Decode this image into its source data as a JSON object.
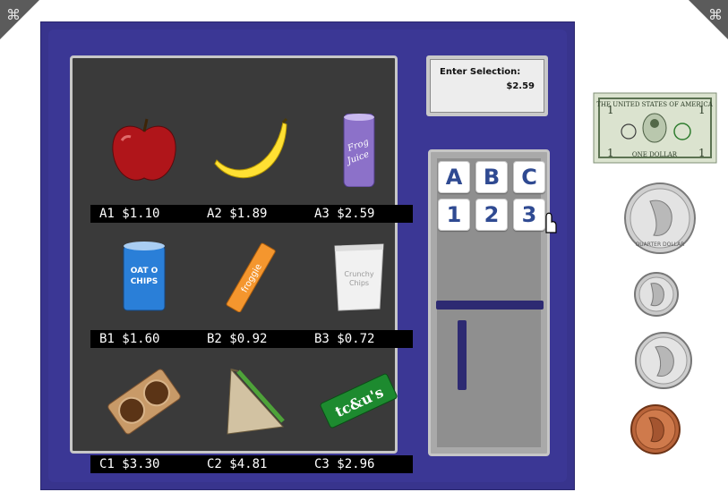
{
  "display": {
    "title": "Enter Selection:",
    "price": "$2.59"
  },
  "products": [
    {
      "code": "A1 $1.10",
      "name": "apple"
    },
    {
      "code": "A2 $1.89",
      "name": "banana"
    },
    {
      "code": "A3 $2.59",
      "name": "frog-juice-can",
      "text": "Frog Juice"
    },
    {
      "code": "B1 $1.60",
      "name": "oat-o-chips-can",
      "text": "OAT O CHIPS"
    },
    {
      "code": "B2 $0.92",
      "name": "froggie-bar",
      "text": "froggie"
    },
    {
      "code": "B3 $0.72",
      "name": "chips-bag",
      "text": "Crunchy Chips"
    },
    {
      "code": "C1 $3.30",
      "name": "cookies-pack"
    },
    {
      "code": "C2 $4.81",
      "name": "sandwich"
    },
    {
      "code": "C3 $2.96",
      "name": "candy-bar",
      "text": "tc&u's"
    }
  ],
  "keypad": {
    "row1": [
      "A",
      "B",
      "C"
    ],
    "row2": [
      "1",
      "2",
      "3"
    ]
  },
  "money": {
    "bill": {
      "name": "one-dollar-bill",
      "top_text": "THE UNITED STATES OF AMERICA",
      "bottom_text": "ONE DOLLAR",
      "corner": "1"
    },
    "quarter": {
      "name": "quarter",
      "text": "QUARTER DOLLAR"
    },
    "dime": {
      "name": "dime"
    },
    "nickel": {
      "name": "nickel"
    },
    "penny": {
      "name": "penny"
    }
  },
  "colors": {
    "machine": "#38348d",
    "window": "#3a3a3a",
    "key_text": "#2f4a92"
  }
}
